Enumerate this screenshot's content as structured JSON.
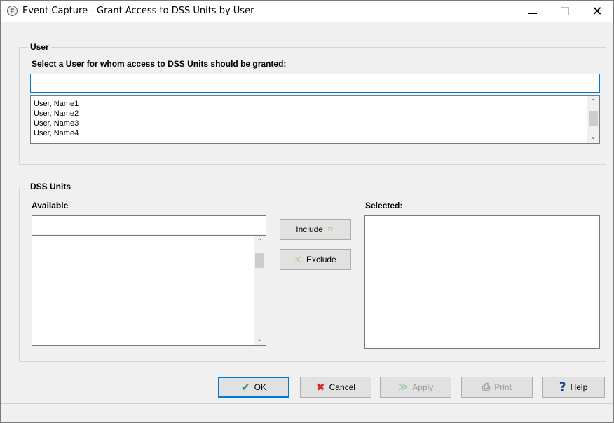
{
  "window": {
    "title": "Event Capture - Grant Access to DSS Units by User",
    "icon_letter": "E"
  },
  "user_group": {
    "legend": "User",
    "prompt": "Select a User for whom access to DSS Units should be granted:",
    "search_value": "",
    "users": [
      "User, Name1",
      "User, Name2",
      "User, Name3",
      "User, Name4"
    ]
  },
  "dss_group": {
    "legend": "DSS Units",
    "available_label": "Available",
    "selected_label": "Selected:",
    "available_filter_value": "",
    "available_items": [],
    "selected_items": []
  },
  "buttons": {
    "include": "Include",
    "exclude": "Exclude",
    "ok": "OK",
    "cancel": "Cancel",
    "apply": "Apply",
    "print": "Print",
    "help": "Help"
  },
  "icons": {
    "ok_color": "#2e8b57",
    "cancel_color": "#d9281f",
    "help_color": "#1a3d8f"
  }
}
